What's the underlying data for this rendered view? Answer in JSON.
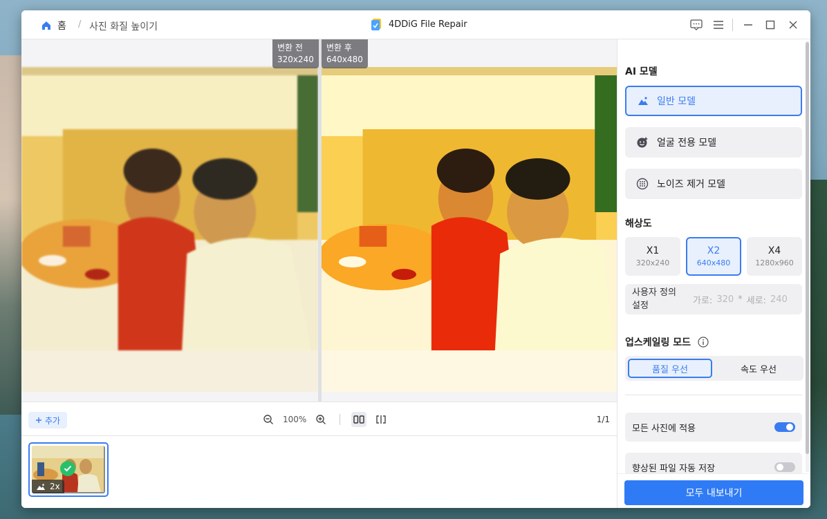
{
  "titlebar": {
    "home_label": "홈",
    "separator": "/",
    "current_page": "사진 화질 높이기",
    "app_name": "4DDiG File Repair"
  },
  "preview": {
    "before_label": "변환 전",
    "before_size": "320x240",
    "after_label": "변환 후",
    "after_size": "640x480"
  },
  "toolbar": {
    "add_label": "추가",
    "zoom": "100%",
    "page_count": "1/1"
  },
  "thumbnail": {
    "badge": "2x"
  },
  "panel": {
    "ai_model_title": "AI 모델",
    "models": [
      {
        "label": "일반 모델",
        "icon": "landscape-icon",
        "selected": true
      },
      {
        "label": "얼굴 전용 모델",
        "icon": "face-icon",
        "selected": false
      },
      {
        "label": "노이즈 제거 모델",
        "icon": "noise-icon",
        "selected": false
      }
    ],
    "resolution_title": "해상도",
    "resolutions": [
      {
        "scale": "X1",
        "size": "320x240",
        "selected": false
      },
      {
        "scale": "X2",
        "size": "640x480",
        "selected": true
      },
      {
        "scale": "X4",
        "size": "1280x960",
        "selected": false
      }
    ],
    "custom": {
      "label": "사용자 정의 설정",
      "width_label": "가로:",
      "width_value": "320",
      "multiply": "*",
      "height_label": "세로:",
      "height_value": "240"
    },
    "upscale_mode_title": "업스케일링 모드",
    "modes": [
      "품질 우선",
      "속도 우선"
    ],
    "active_mode": "품질 우선",
    "apply_all_label": "모든 사진에 적용",
    "apply_all_on": true,
    "auto_save_label": "향상된 파일 자동 저장",
    "auto_save_on": false,
    "export_label": "모두 내보내기"
  },
  "colors": {
    "accent": "#3a7cf0",
    "export_button": "#2f7bf5",
    "check_green": "#27c06a"
  }
}
